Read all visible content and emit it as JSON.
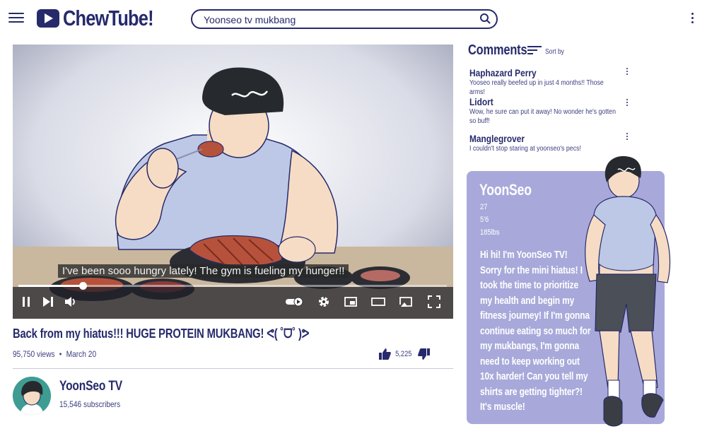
{
  "header": {
    "menu_icon": "hamburger-icon",
    "logo_text": "ChewTube!",
    "search": {
      "value": "Yoonseo tv mukbang",
      "icon": "search-icon"
    },
    "more_icon": "vertical-dots-icon"
  },
  "video": {
    "caption": "I've been sooo hungry lately! The gym is fueling my hunger!!",
    "progress_fraction": 0.15,
    "controls": [
      "pause-icon",
      "next-icon",
      "volume-icon",
      "autoplay-toggle-icon",
      "settings-gear-icon",
      "miniplayer-icon",
      "theater-mode-icon",
      "cast-icon",
      "fullscreen-icon"
    ]
  },
  "info": {
    "title": "Back from my hiatus!!! HUGE PROTEIN MUKBANG! ᕙ( ˚ᗜ˚ )ᕗ",
    "views": "95,750 views",
    "separator": "•",
    "date": "March 20",
    "likes": "5,225"
  },
  "channel": {
    "name": "YoonSeo TV",
    "subscribers": "15,546 subscribers"
  },
  "comments": {
    "heading": "Comments",
    "sort_label": "Sort by",
    "items": [
      {
        "author": "Haphazard Perry",
        "text": "Yooseo really beefed up in just 4 months!! Those arms!"
      },
      {
        "author": "Lidort",
        "text": "Wow, he sure can put it away! No wonder he's gotten so buff!"
      },
      {
        "author": "Manglegrover",
        "text": "I couldn't stop staring at yoonseo's pecs!"
      }
    ]
  },
  "profile": {
    "name": "YoonSeo",
    "age": "27",
    "height": "5'6",
    "weight": "185lbs",
    "bio_lines": [
      "Hi hi! I'm YoonSeo TV!",
      "Sorry for the mini hiatus! I",
      "took the time to prioritize",
      "my health and begin my",
      "fitness journey! If I'm gonna",
      "continue eating so much for",
      "my mukbangs, I'm gonna",
      "need to keep working out",
      "10x harder! Can you tell my",
      "shirts are getting tighter?!",
      "It's muscle!"
    ]
  },
  "colors": {
    "brand": "#262a6b",
    "card": "#a8a9da",
    "avatar_bg": "#3e9c93"
  }
}
